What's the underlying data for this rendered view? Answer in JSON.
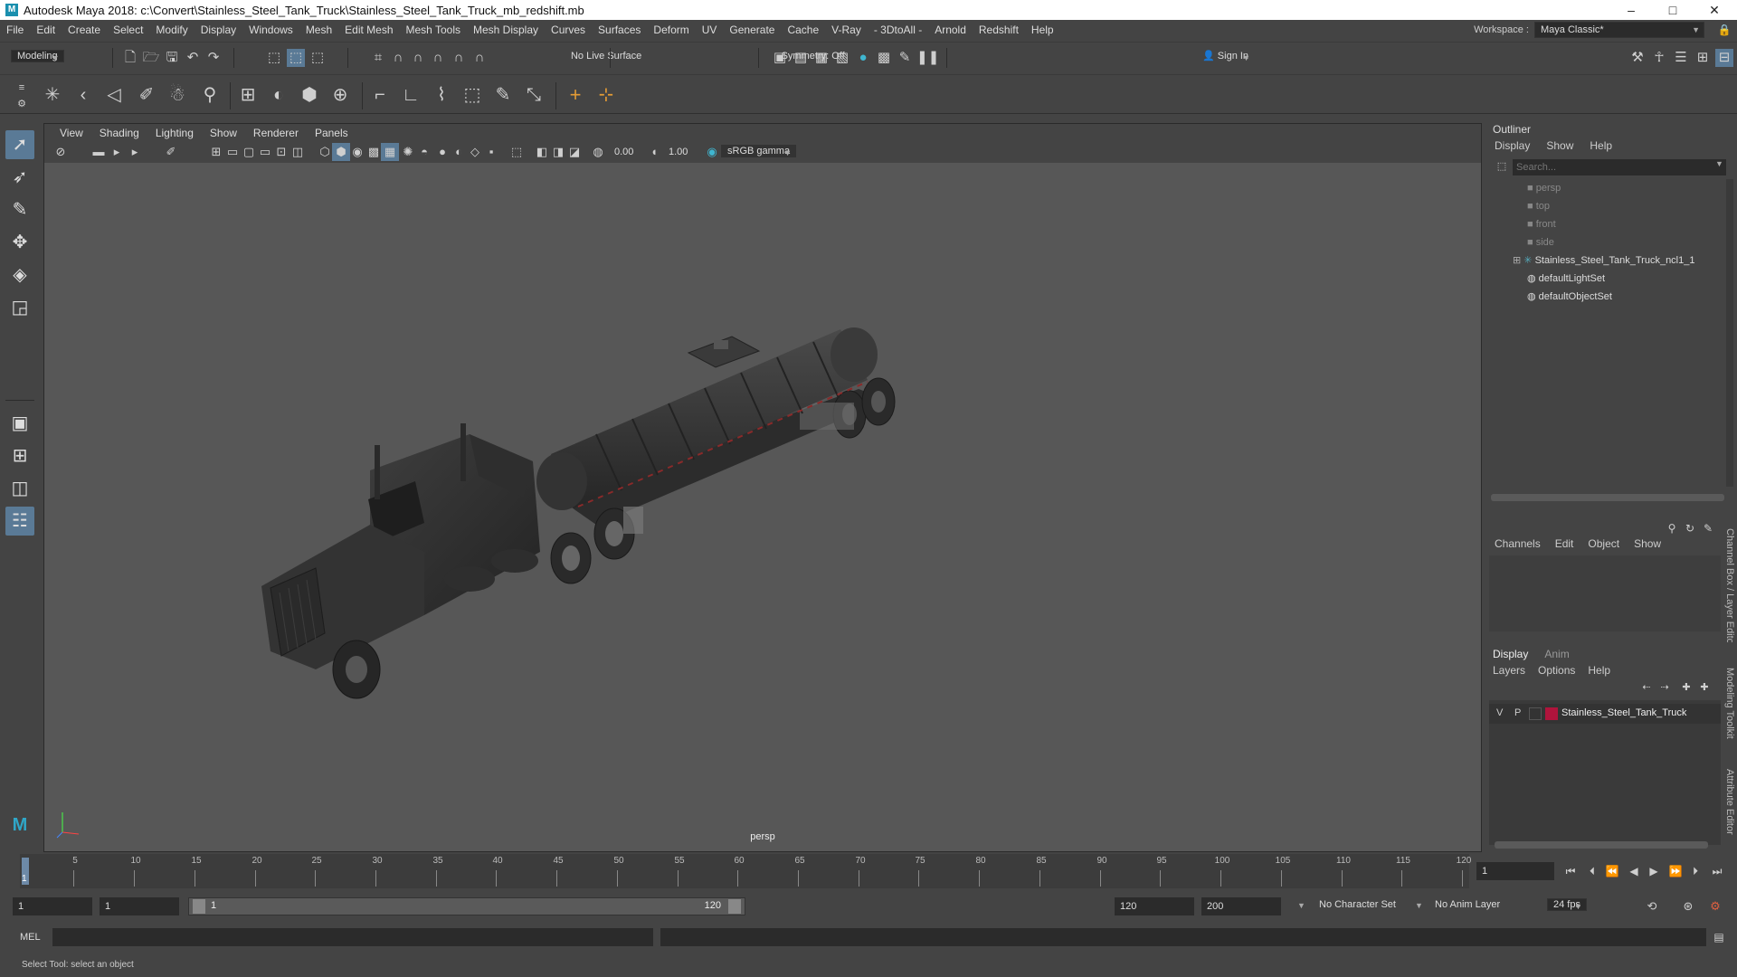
{
  "title_bar": {
    "title": "Autodesk Maya 2018: c:\\Convert\\Stainless_Steel_Tank_Truck\\Stainless_Steel_Tank_Truck_mb_redshift.mb",
    "minimize": "–",
    "maximize": "□",
    "close": "✕"
  },
  "menu": {
    "items": [
      "File",
      "Edit",
      "Create",
      "Select",
      "Modify",
      "Display",
      "Windows",
      "Mesh",
      "Edit Mesh",
      "Mesh Tools",
      "Mesh Display",
      "Curves",
      "Surfaces",
      "Deform",
      "UV",
      "Generate",
      "Cache",
      "V-Ray",
      "- 3DtoAll -",
      "Arnold",
      "Redshift",
      "Help"
    ],
    "workspace_label": "Workspace :",
    "workspace_value": "Maya Classic*"
  },
  "status_line": {
    "mode": "Modeling",
    "live_surface": "No Live Surface",
    "symmetry": "Symmetry: Off",
    "sign_in": "Sign In"
  },
  "viewport": {
    "menu": [
      "View",
      "Shading",
      "Lighting",
      "Show",
      "Renderer",
      "Panels"
    ],
    "exposure": "0.00",
    "gamma": "1.00",
    "color_space": "sRGB gamma",
    "camera_label": "persp"
  },
  "outliner": {
    "title": "Outliner",
    "menu": [
      "Display",
      "Show",
      "Help"
    ],
    "search_placeholder": "Search...",
    "items": [
      {
        "label": "persp"
      },
      {
        "label": "top"
      },
      {
        "label": "front"
      },
      {
        "label": "side"
      },
      {
        "label": "Stainless_Steel_Tank_Truck_ncl1_1"
      },
      {
        "label": "defaultLightSet"
      },
      {
        "label": "defaultObjectSet"
      }
    ]
  },
  "channel_box": {
    "menu": [
      "Channels",
      "Edit",
      "Object",
      "Show"
    ],
    "side_tab": "Channel Box / Layer Editor"
  },
  "layer_editor": {
    "tabs": [
      "Display",
      "Anim"
    ],
    "menu": [
      "Layers",
      "Options",
      "Help"
    ],
    "layer": {
      "v": "V",
      "p": "P",
      "name": "Stainless_Steel_Tank_Truck",
      "color": "#b0143c"
    }
  },
  "side_tabs": [
    "Modeling Toolkit",
    "Attribute Editor"
  ],
  "time_slider": {
    "ticks": [
      "5",
      "10",
      "15",
      "20",
      "25",
      "30",
      "35",
      "40",
      "45",
      "50",
      "55",
      "60",
      "65",
      "70",
      "75",
      "80",
      "85",
      "90",
      "95",
      "100",
      "105",
      "110",
      "115",
      "120"
    ],
    "current_frame_marker": "1",
    "current_frame_field": "1"
  },
  "range_slider": {
    "start": "1",
    "anim_start": "1",
    "range_left": "1",
    "range_right": "120",
    "anim_end": "120",
    "end": "200",
    "character_set": "No Character Set",
    "anim_layer": "No Anim Layer",
    "fps": "24 fps"
  },
  "command_line": {
    "label": "MEL"
  },
  "help_line": {
    "text": "Select Tool: select an object"
  }
}
